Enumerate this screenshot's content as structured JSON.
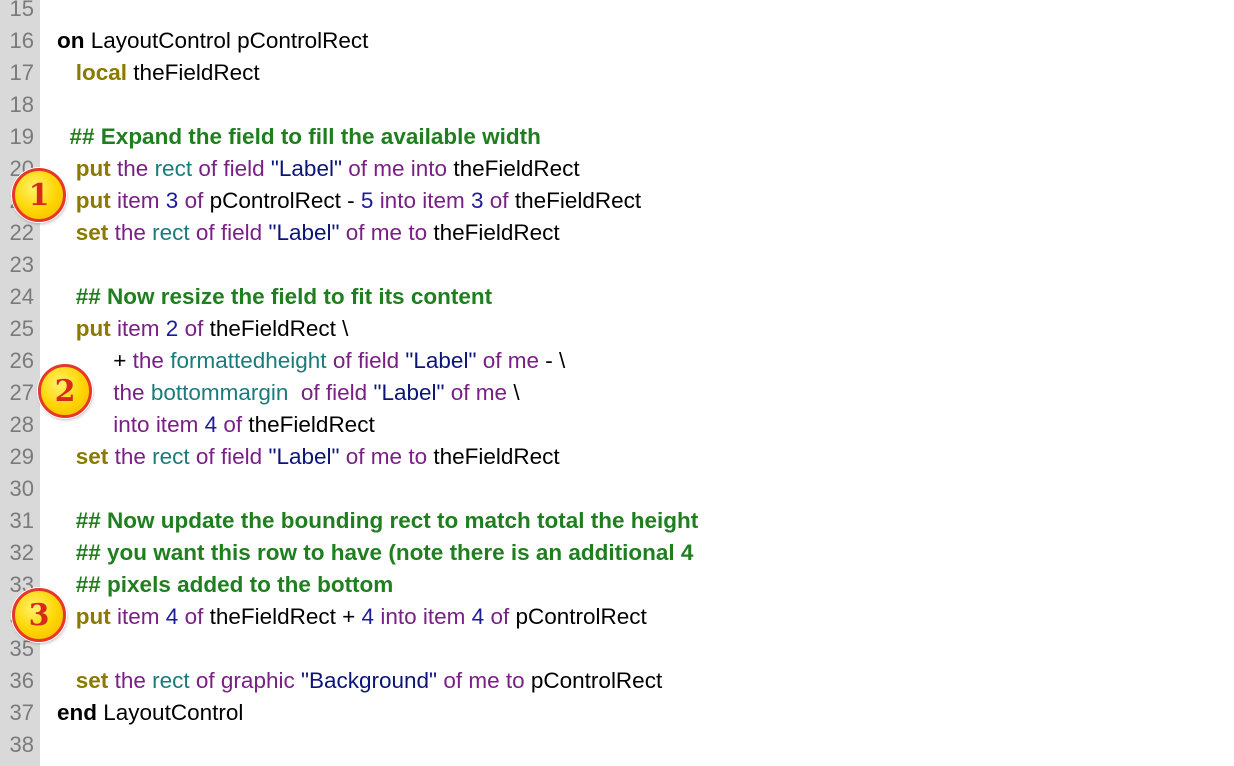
{
  "editor": {
    "lines": [
      {
        "n": "15",
        "tokens": []
      },
      {
        "n": "16",
        "tokens": [
          {
            "t": "on",
            "c": "kw"
          },
          {
            "t": " LayoutControl pControlRect"
          }
        ]
      },
      {
        "n": "17",
        "tokens": [
          {
            "t": "   "
          },
          {
            "t": "local",
            "c": "cmd"
          },
          {
            "t": " theFieldRect"
          }
        ]
      },
      {
        "n": "18",
        "tokens": []
      },
      {
        "n": "19",
        "tokens": [
          {
            "t": "  "
          },
          {
            "t": "## Expand the field to fill the available width",
            "c": "c"
          }
        ]
      },
      {
        "n": "20",
        "tokens": [
          {
            "t": "   "
          },
          {
            "t": "put",
            "c": "cmd"
          },
          {
            "t": " "
          },
          {
            "t": "the",
            "c": "p"
          },
          {
            "t": " "
          },
          {
            "t": "rect",
            "c": "t"
          },
          {
            "t": " "
          },
          {
            "t": "of",
            "c": "p"
          },
          {
            "t": " "
          },
          {
            "t": "field",
            "c": "p"
          },
          {
            "t": " "
          },
          {
            "t": "\"Label\"",
            "c": "s"
          },
          {
            "t": " "
          },
          {
            "t": "of",
            "c": "p"
          },
          {
            "t": " "
          },
          {
            "t": "me",
            "c": "p"
          },
          {
            "t": " "
          },
          {
            "t": "into",
            "c": "p"
          },
          {
            "t": " theFieldRect"
          }
        ]
      },
      {
        "n": "21",
        "tokens": [
          {
            "t": "   "
          },
          {
            "t": "put",
            "c": "cmd"
          },
          {
            "t": " "
          },
          {
            "t": "item",
            "c": "p"
          },
          {
            "t": " "
          },
          {
            "t": "3",
            "c": "n"
          },
          {
            "t": " "
          },
          {
            "t": "of",
            "c": "p"
          },
          {
            "t": " pControlRect - "
          },
          {
            "t": "5",
            "c": "n"
          },
          {
            "t": " "
          },
          {
            "t": "into",
            "c": "p"
          },
          {
            "t": " "
          },
          {
            "t": "item",
            "c": "p"
          },
          {
            "t": " "
          },
          {
            "t": "3",
            "c": "n"
          },
          {
            "t": " "
          },
          {
            "t": "of",
            "c": "p"
          },
          {
            "t": " theFieldRect"
          }
        ]
      },
      {
        "n": "22",
        "tokens": [
          {
            "t": "   "
          },
          {
            "t": "set",
            "c": "cmd"
          },
          {
            "t": " "
          },
          {
            "t": "the",
            "c": "p"
          },
          {
            "t": " "
          },
          {
            "t": "rect",
            "c": "t"
          },
          {
            "t": " "
          },
          {
            "t": "of",
            "c": "p"
          },
          {
            "t": " "
          },
          {
            "t": "field",
            "c": "p"
          },
          {
            "t": " "
          },
          {
            "t": "\"Label\"",
            "c": "s"
          },
          {
            "t": " "
          },
          {
            "t": "of",
            "c": "p"
          },
          {
            "t": " "
          },
          {
            "t": "me",
            "c": "p"
          },
          {
            "t": " "
          },
          {
            "t": "to",
            "c": "p"
          },
          {
            "t": " theFieldRect"
          }
        ]
      },
      {
        "n": "23",
        "tokens": []
      },
      {
        "n": "24",
        "tokens": [
          {
            "t": "   "
          },
          {
            "t": "## Now resize the field to fit its content",
            "c": "c"
          }
        ]
      },
      {
        "n": "25",
        "tokens": [
          {
            "t": "   "
          },
          {
            "t": "put",
            "c": "cmd"
          },
          {
            "t": " "
          },
          {
            "t": "item",
            "c": "p"
          },
          {
            "t": " "
          },
          {
            "t": "2",
            "c": "n"
          },
          {
            "t": " "
          },
          {
            "t": "of",
            "c": "p"
          },
          {
            "t": " theFieldRect \\"
          }
        ]
      },
      {
        "n": "26",
        "tokens": [
          {
            "t": "         + "
          },
          {
            "t": "the",
            "c": "p"
          },
          {
            "t": " "
          },
          {
            "t": "formattedheight",
            "c": "t"
          },
          {
            "t": " "
          },
          {
            "t": "of",
            "c": "p"
          },
          {
            "t": " "
          },
          {
            "t": "field",
            "c": "p"
          },
          {
            "t": " "
          },
          {
            "t": "\"Label\"",
            "c": "s"
          },
          {
            "t": " "
          },
          {
            "t": "of",
            "c": "p"
          },
          {
            "t": " "
          },
          {
            "t": "me",
            "c": "p"
          },
          {
            "t": " - \\"
          }
        ]
      },
      {
        "n": "27",
        "tokens": [
          {
            "t": "         "
          },
          {
            "t": "the",
            "c": "p"
          },
          {
            "t": " "
          },
          {
            "t": "bottommargin",
            "c": "t"
          },
          {
            "t": "  "
          },
          {
            "t": "of",
            "c": "p"
          },
          {
            "t": " "
          },
          {
            "t": "field",
            "c": "p"
          },
          {
            "t": " "
          },
          {
            "t": "\"Label\"",
            "c": "s"
          },
          {
            "t": " "
          },
          {
            "t": "of",
            "c": "p"
          },
          {
            "t": " "
          },
          {
            "t": "me",
            "c": "p"
          },
          {
            "t": " \\"
          }
        ]
      },
      {
        "n": "28",
        "tokens": [
          {
            "t": "         "
          },
          {
            "t": "into",
            "c": "p"
          },
          {
            "t": " "
          },
          {
            "t": "item",
            "c": "p"
          },
          {
            "t": " "
          },
          {
            "t": "4",
            "c": "n"
          },
          {
            "t": " "
          },
          {
            "t": "of",
            "c": "p"
          },
          {
            "t": " theFieldRect"
          }
        ]
      },
      {
        "n": "29",
        "tokens": [
          {
            "t": "   "
          },
          {
            "t": "set",
            "c": "cmd"
          },
          {
            "t": " "
          },
          {
            "t": "the",
            "c": "p"
          },
          {
            "t": " "
          },
          {
            "t": "rect",
            "c": "t"
          },
          {
            "t": " "
          },
          {
            "t": "of",
            "c": "p"
          },
          {
            "t": " "
          },
          {
            "t": "field",
            "c": "p"
          },
          {
            "t": " "
          },
          {
            "t": "\"Label\"",
            "c": "s"
          },
          {
            "t": " "
          },
          {
            "t": "of",
            "c": "p"
          },
          {
            "t": " "
          },
          {
            "t": "me",
            "c": "p"
          },
          {
            "t": " "
          },
          {
            "t": "to",
            "c": "p"
          },
          {
            "t": " theFieldRect"
          }
        ]
      },
      {
        "n": "30",
        "tokens": []
      },
      {
        "n": "31",
        "tokens": [
          {
            "t": "   "
          },
          {
            "t": "## Now update the bounding rect to match total the height",
            "c": "c"
          }
        ]
      },
      {
        "n": "32",
        "tokens": [
          {
            "t": "   "
          },
          {
            "t": "## you want this row to have (note there is an additional 4",
            "c": "c"
          }
        ]
      },
      {
        "n": "33",
        "tokens": [
          {
            "t": "   "
          },
          {
            "t": "## pixels added to the bottom",
            "c": "c"
          }
        ]
      },
      {
        "n": "34",
        "tokens": [
          {
            "t": "   "
          },
          {
            "t": "put",
            "c": "cmd"
          },
          {
            "t": " "
          },
          {
            "t": "item",
            "c": "p"
          },
          {
            "t": " "
          },
          {
            "t": "4",
            "c": "n"
          },
          {
            "t": " "
          },
          {
            "t": "of",
            "c": "p"
          },
          {
            "t": " theFieldRect + "
          },
          {
            "t": "4",
            "c": "n"
          },
          {
            "t": " "
          },
          {
            "t": "into",
            "c": "p"
          },
          {
            "t": " "
          },
          {
            "t": "item",
            "c": "p"
          },
          {
            "t": " "
          },
          {
            "t": "4",
            "c": "n"
          },
          {
            "t": " "
          },
          {
            "t": "of",
            "c": "p"
          },
          {
            "t": " pControlRect"
          }
        ]
      },
      {
        "n": "35",
        "tokens": []
      },
      {
        "n": "36",
        "tokens": [
          {
            "t": "   "
          },
          {
            "t": "set",
            "c": "cmd"
          },
          {
            "t": " "
          },
          {
            "t": "the",
            "c": "p"
          },
          {
            "t": " "
          },
          {
            "t": "rect",
            "c": "t"
          },
          {
            "t": " "
          },
          {
            "t": "of",
            "c": "p"
          },
          {
            "t": " "
          },
          {
            "t": "graphic",
            "c": "p"
          },
          {
            "t": " "
          },
          {
            "t": "\"Background\"",
            "c": "s"
          },
          {
            "t": " "
          },
          {
            "t": "of",
            "c": "p"
          },
          {
            "t": " "
          },
          {
            "t": "me",
            "c": "p"
          },
          {
            "t": " "
          },
          {
            "t": "to",
            "c": "p"
          },
          {
            "t": " pControlRect"
          }
        ]
      },
      {
        "n": "37",
        "tokens": [
          {
            "t": "end",
            "c": "kw"
          },
          {
            "t": " LayoutControl"
          }
        ]
      },
      {
        "n": "38",
        "tokens": []
      }
    ]
  },
  "callouts": {
    "one": "1",
    "two": "2",
    "three": "3"
  },
  "colors": {
    "gutter": "#d9d9d9",
    "comment": "#1f7f1f",
    "command": "#8a7a00",
    "keyword_purple": "#7a1f86",
    "property_teal": "#1a7b7b",
    "string_navy": "#0b1578",
    "callout_fill": "#ffd400",
    "callout_ring": "#e8362a"
  }
}
